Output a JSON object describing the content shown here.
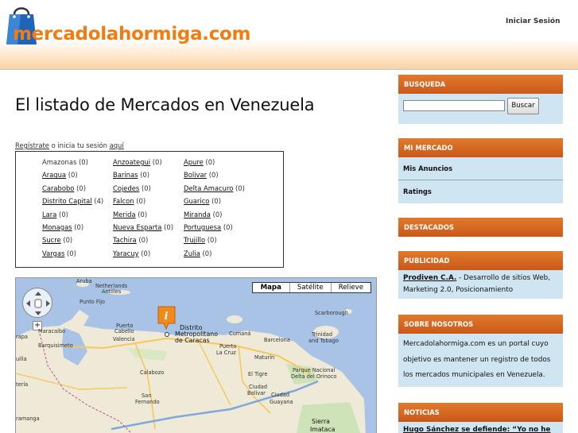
{
  "header": {
    "logo_text": "mercadolahormiga.com",
    "login_label": "Iniciar Sesión",
    "brand_color": "#f07c12"
  },
  "main": {
    "title": "El listado de Mercados en Venezuela",
    "register": {
      "register_link": "Regístrate",
      "middle_text": " o inicia tu sesión ",
      "here_link": "aquí"
    },
    "states_columns": [
      [
        {
          "name": "Amazonas",
          "count": "(0)",
          "linked": false
        },
        {
          "name": "Aragua",
          "count": "(0)",
          "linked": true
        },
        {
          "name": "Carabobo",
          "count": "(0)",
          "linked": true
        },
        {
          "name": "Distrito Capital",
          "count": "(4)",
          "linked": true
        },
        {
          "name": "Lara",
          "count": "(0)",
          "linked": true
        },
        {
          "name": "Monagas",
          "count": "(0)",
          "linked": true
        },
        {
          "name": "Sucre",
          "count": "(0)",
          "linked": true
        },
        {
          "name": "Vargas",
          "count": "(0)",
          "linked": true
        }
      ],
      [
        {
          "name": "Anzoategui",
          "count": "(0)",
          "linked": true
        },
        {
          "name": "Barinas",
          "count": "(0)",
          "linked": true
        },
        {
          "name": "Cojedes",
          "count": "(0)",
          "linked": true
        },
        {
          "name": "Falcon",
          "count": "(0)",
          "linked": true
        },
        {
          "name": "Merida",
          "count": "(0)",
          "linked": true
        },
        {
          "name": "Nueva Esparta",
          "count": "(0)",
          "linked": true
        },
        {
          "name": "Tachira",
          "count": "(0)",
          "linked": true
        },
        {
          "name": "Yaracuy",
          "count": "(0)",
          "linked": true
        }
      ],
      [
        {
          "name": "Apure",
          "count": "(0)",
          "linked": true
        },
        {
          "name": "Bolivar",
          "count": "(0)",
          "linked": true
        },
        {
          "name": "Delta Amacuro",
          "count": "(0)",
          "linked": true
        },
        {
          "name": "Guarico",
          "count": "(0)",
          "linked": true
        },
        {
          "name": "Miranda",
          "count": "(0)",
          "linked": true
        },
        {
          "name": "Portuguesa",
          "count": "(0)",
          "linked": true
        },
        {
          "name": "Trujillo",
          "count": "(0)",
          "linked": true
        },
        {
          "name": "Zulia",
          "count": "(0)",
          "linked": true
        }
      ]
    ],
    "map": {
      "type_buttons": [
        "Mapa",
        "Satélite",
        "Relieve"
      ],
      "zoom_in": "+",
      "marker_icon": "info-marker-icon",
      "labels": [
        {
          "text": "Aruba",
          "cls": ""
        },
        {
          "text": "Netherlands",
          "cls": ""
        },
        {
          "text": "Antilles",
          "cls": ""
        },
        {
          "text": "Punto Fijo",
          "cls": ""
        },
        {
          "text": "Maracaibo",
          "cls": ""
        },
        {
          "text": "Barquisimeto",
          "cls": ""
        },
        {
          "text": "Puerto",
          "cls": ""
        },
        {
          "text": "Cabello",
          "cls": ""
        },
        {
          "text": "Valencia",
          "cls": ""
        },
        {
          "text": "Distrito",
          "cls": "big"
        },
        {
          "text": "Metropolitano",
          "cls": "big"
        },
        {
          "text": "de Caracas",
          "cls": "big"
        },
        {
          "text": "Scarborough",
          "cls": ""
        },
        {
          "text": "Trinidad",
          "cls": ""
        },
        {
          "text": "and Tobago",
          "cls": ""
        },
        {
          "text": "Cumaná",
          "cls": ""
        },
        {
          "text": "Barcelona",
          "cls": ""
        },
        {
          "text": "Puerto",
          "cls": ""
        },
        {
          "text": "La Cruz",
          "cls": ""
        },
        {
          "text": "Maturín",
          "cls": ""
        },
        {
          "text": "Calabozo",
          "cls": ""
        },
        {
          "text": "El Tigre",
          "cls": ""
        },
        {
          "text": "Parque Nacional",
          "cls": ""
        },
        {
          "text": "Delta del Orinoco",
          "cls": ""
        },
        {
          "text": "San",
          "cls": ""
        },
        {
          "text": "Fernando",
          "cls": ""
        },
        {
          "text": "Ciudad",
          "cls": ""
        },
        {
          "text": "Bolívar",
          "cls": ""
        },
        {
          "text": "Ciudad",
          "cls": ""
        },
        {
          "text": "Guayana",
          "cls": ""
        },
        {
          "text": "Sierra",
          "cls": "big"
        },
        {
          "text": "Imataca",
          "cls": "big"
        },
        {
          "text": "rapa",
          "cls": ""
        },
        {
          "text": "uilla",
          "cls": ""
        },
        {
          "text": "tería",
          "cls": ""
        },
        {
          "text": "ramanga",
          "cls": ""
        }
      ]
    }
  },
  "sidebar": {
    "search": {
      "title": "BUSQUEDA",
      "button": "Buscar",
      "value": ""
    },
    "my_market": {
      "title": "MI MERCADO",
      "items": [
        "Mis Anuncios",
        "Ratings"
      ]
    },
    "featured": {
      "title": "DESTACADOS"
    },
    "ads": {
      "title": "PUBLICIDAD",
      "link": "Prodiven C.A.",
      "text": " - Desarrollo de sitios Web, Marketing 2.0, Posicionamiento"
    },
    "about": {
      "title": "SOBRE NOSOTROS",
      "text": "Mercadolahormiga.com es un portal cuyo objetivo es mantener un registro de todos los mercados municipales en Venezuela."
    },
    "news": {
      "title": "NOTICIAS",
      "headline": "Hugo Sánchez se defiende: “Yo no he"
    },
    "accent_color": "#d2621f",
    "panel_bg": "#cfe6f2"
  }
}
